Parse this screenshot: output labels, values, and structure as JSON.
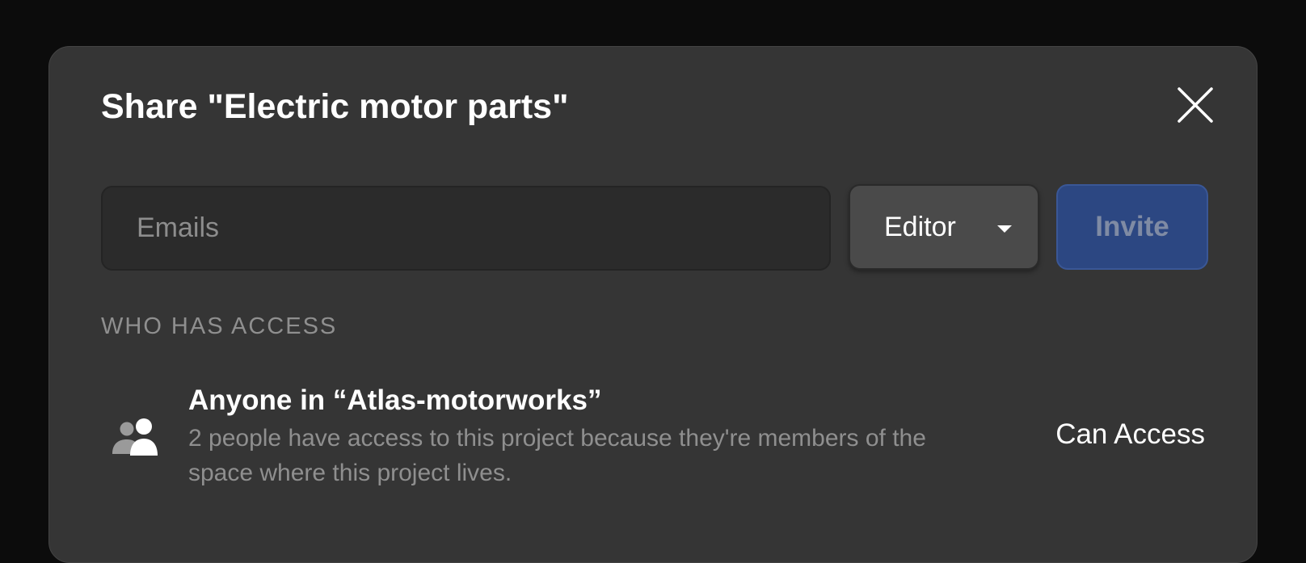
{
  "dialog": {
    "title": "Share \"Electric motor parts\"",
    "close_icon": "close-icon"
  },
  "invite_form": {
    "email_placeholder": "Emails",
    "email_value": "",
    "role_selected": "Editor",
    "invite_label": "Invite"
  },
  "access_section": {
    "heading": "WHO HAS ACCESS",
    "entries": [
      {
        "icon": "people-icon",
        "title": "Anyone in “Atlas-motorworks”",
        "description": "2 people have access to this project because they're members of the space where this project lives.",
        "level": "Can Access"
      }
    ]
  },
  "colors": {
    "backdrop": "#0c0c0c",
    "dialog_bg": "#353535",
    "input_bg": "#2b2b2b",
    "select_bg": "#4a4a4a",
    "invite_bg": "#2c4782",
    "muted_text": "#8f8f8f"
  }
}
